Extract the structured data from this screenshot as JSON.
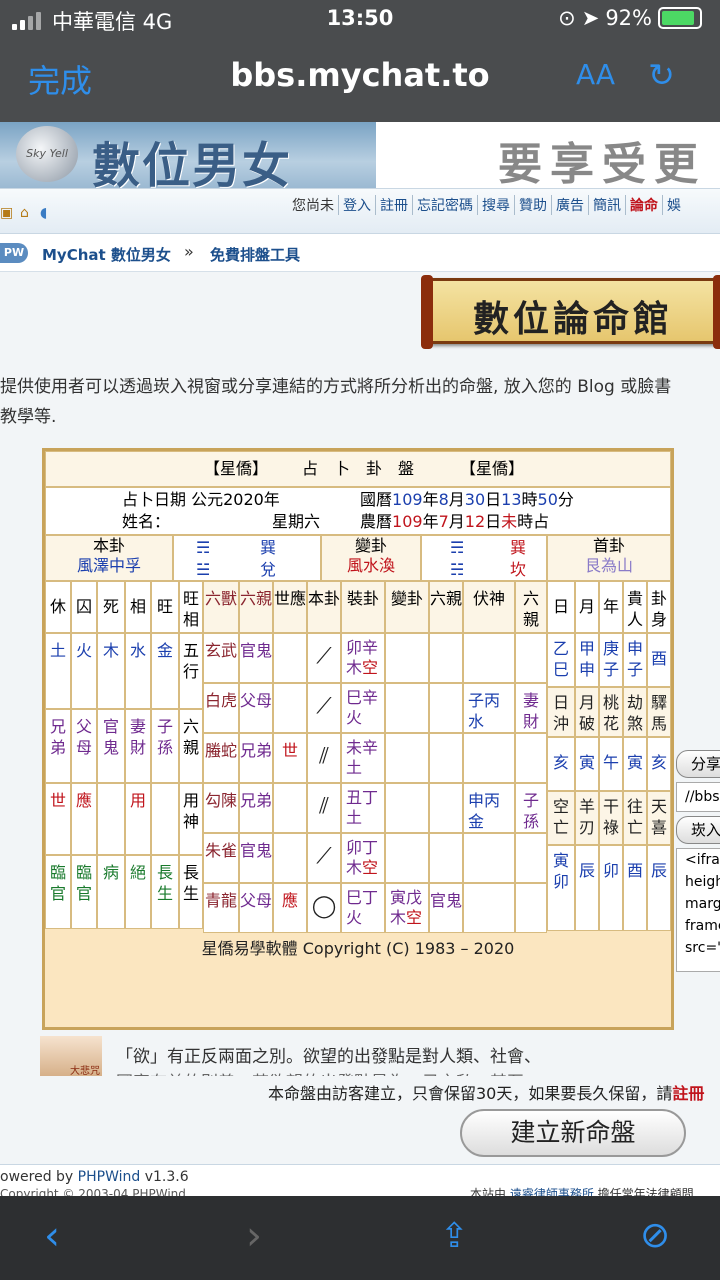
{
  "status": {
    "carrier": "中華電信  4G",
    "time": "13:50",
    "battery": "92%"
  },
  "browser": {
    "done": "完成",
    "url": "bbs.mychat.to",
    "text_size": "AA"
  },
  "banner": {
    "logo_moon": "Sky Yell",
    "logo": "數位男女",
    "ad": "要享受更"
  },
  "subnav": {
    "links": [
      "您尚未",
      "登入",
      "註冊",
      "忘記密碼",
      "搜尋",
      "贊助",
      "廣告",
      "簡訊",
      "論命",
      "娛"
    ]
  },
  "crumb": {
    "pw": "PW",
    "site": "MyChat 數位男女",
    "sep": "»",
    "page": "免費排盤工具"
  },
  "sign": "數位論命館",
  "intro": [
    "提供使用者可以透過崁入視窗或分享連結的方式將所分析出的命盤, 放入您的 Blog 或臉書",
    "教學等."
  ],
  "chart": {
    "header": {
      "left": "【星僑】",
      "title": "占　卜　卦　盤",
      "right": "【星僑】"
    },
    "date_label": "占卜日期 公元2020年",
    "name_label": "姓名：",
    "weekday": "星期六",
    "guoli": {
      "prefix": "國曆",
      "year": "109",
      "ymark": "年",
      "month": "8",
      "mmark": "月",
      "day": "30",
      "dmark": "日",
      "hour": "13",
      "hmark": "時",
      "min": "50",
      "mn": "分"
    },
    "nongli": {
      "prefix": "農曆",
      "year": "109",
      "ymark": "年",
      "month": "7",
      "mmark": "月",
      "day": "12",
      "dmark": "日",
      "hour": "未",
      "end": "時占"
    },
    "ben": {
      "label": "本卦",
      "name": "風澤中孚",
      "tri_top": "☴",
      "tri_top_name": "巽",
      "tri_bot": "☱",
      "tri_bot_name": "兌"
    },
    "bian": {
      "label": "變卦",
      "name": "風水渙",
      "tri_top": "☴",
      "tri_top_name": "巽",
      "tri_bot": "☵",
      "tri_bot_name": "坎"
    },
    "shou": {
      "label": "首卦",
      "name": "艮為山"
    },
    "headers": {
      "xiu": "休",
      "qiu": "囚",
      "si": "死",
      "xiang": "相",
      "wang": "旺",
      "wangxiang": "旺相",
      "liushou": "六獸",
      "liuqin": "六親",
      "shiying": "世應",
      "bengua": "本卦",
      "zhuanggua": "裝卦",
      "biangua": "變卦",
      "liuqin2": "六親",
      "fushen": "伏神",
      "liuqin3": "六親",
      "ri": "日",
      "yue": "月",
      "nian": "年",
      "guiren": "貴人",
      "guashen": "卦身"
    },
    "season": {
      "wuxing": [
        "土",
        "火",
        "木",
        "水",
        "金"
      ],
      "wuxing_label": "五行",
      "liuqin": [
        "兄弟",
        "父母",
        "官鬼",
        "妻財",
        "子孫"
      ],
      "liuqin_label": "六親",
      "yong": [
        "世",
        "應",
        "",
        "用",
        ""
      ],
      "yong_label": "用神",
      "state": [
        "臨官",
        "臨官",
        "病",
        "絕",
        "長生"
      ],
      "state_label": "長生"
    },
    "lines": [
      {
        "beast": "玄武",
        "qin": "官鬼",
        "sy": "",
        "yao": "⟋",
        "zhuang": "卯辛",
        "zel": "木",
        "zk": "空",
        "bian": "",
        "q2": "",
        "fu": "",
        "q3": ""
      },
      {
        "beast": "白虎",
        "qin": "父母",
        "sy": "",
        "yao": "⟋",
        "zhuang": "巳辛",
        "zel": "火",
        "zk": "",
        "bian": "",
        "q2": "",
        "fu": "子丙水",
        "q3": "妻財"
      },
      {
        "beast": "螣蛇",
        "qin": "兄弟",
        "sy": "世",
        "yao": "⫽",
        "zhuang": "未辛",
        "zel": "土",
        "zk": "",
        "bian": "",
        "q2": "",
        "fu": "",
        "q3": ""
      },
      {
        "beast": "勾陳",
        "qin": "兄弟",
        "sy": "",
        "yao": "⫽",
        "zhuang": "丑丁",
        "zel": "土",
        "zk": "",
        "bian": "",
        "q2": "",
        "fu": "申丙金",
        "q3": "子孫"
      },
      {
        "beast": "朱雀",
        "qin": "官鬼",
        "sy": "",
        "yao": "⟋",
        "zhuang": "卯丁",
        "zel": "木",
        "zk": "空",
        "bian": "",
        "q2": "",
        "fu": "",
        "q3": ""
      },
      {
        "beast": "青龍",
        "qin": "父母",
        "sy": "應",
        "yao": "◯",
        "zhuang": "巳丁",
        "zel": "火",
        "zk": "",
        "bian": "寅戊",
        "bel": "木",
        "bk": "空",
        "q2": "官鬼",
        "fu": "",
        "q3": ""
      }
    ],
    "right": {
      "r1": [
        "乙巳",
        "甲申",
        "庚子",
        "申子",
        "酉"
      ],
      "r2": [
        "日沖",
        "月破",
        "桃花",
        "劫煞",
        "驛馬"
      ],
      "r3": [
        "亥",
        "寅",
        "午",
        "寅",
        "亥"
      ],
      "r4": [
        "空亡",
        "羊刃",
        "干祿",
        "往亡",
        "天喜"
      ],
      "r5": [
        "寅卯",
        "辰",
        "卯",
        "酉",
        "辰"
      ]
    },
    "copyright": "星僑易學軟體 Copyright (C) 1983 – 2020"
  },
  "side": {
    "share": "分享",
    "link": "//bbs",
    "embed": "崁入",
    "code": [
      "<ifran",
      "heigh",
      "marg",
      "frame",
      "src='"
    ]
  },
  "ad": {
    "img": "大悲咒",
    "line1": "「欲」有正反兩面之別。欲望的出發點是對人類、社會、",
    "line2": "國家有益的則善；若欲望的出發點是為一己之私，甚至"
  },
  "notice": {
    "text": "本命盤由訪客建立，只會保留30天，如果要長久保留，請",
    "link": "註冊"
  },
  "new_button": "建立新命盤",
  "footer": {
    "powered": "owered by ",
    "phpwind": "PHPWind",
    "ver": " v1.3.6",
    "right_pre": "本站由 ",
    "firm": "遠睿律師事務所",
    "right_post": " 擔任常年法律顧問",
    "left2": "Copyright © 2003-04 PHPWind"
  },
  "colors": {
    "accent": "#2f8eea",
    "chart_border": "#c8a35a",
    "red": "#c0141c",
    "blue": "#1b3fae"
  }
}
